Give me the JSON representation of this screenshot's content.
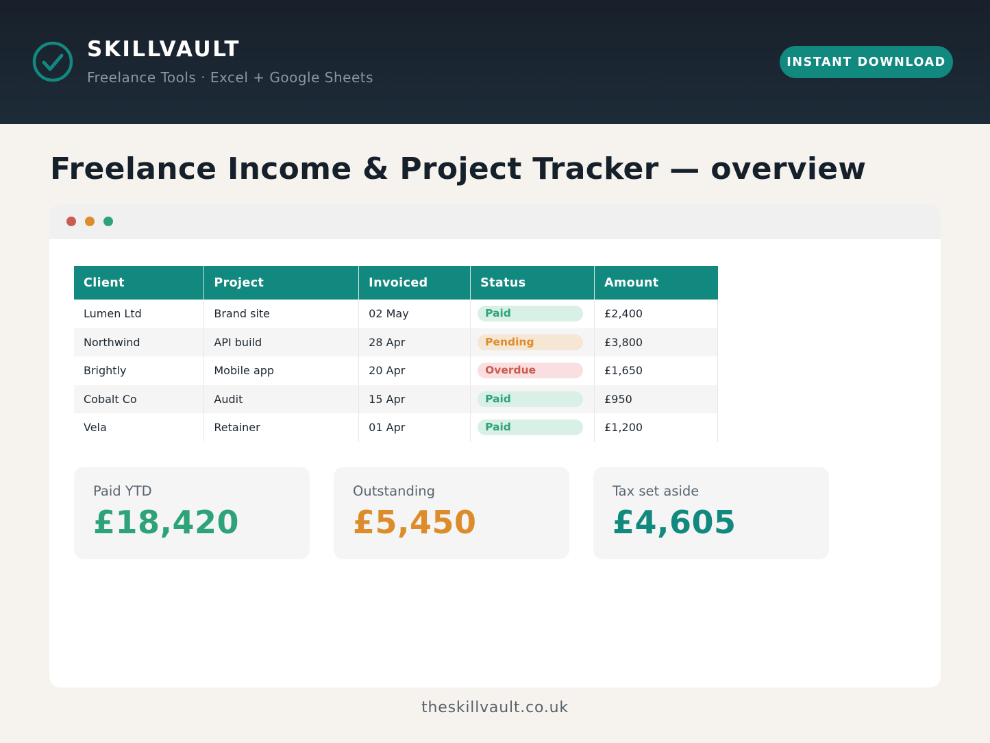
{
  "header": {
    "brand": "SKILLVAULT",
    "tagline": "Freelance Tools · Excel + Google Sheets",
    "cta_label": "INSTANT DOWNLOAD",
    "logo_icon": "check-circle-icon"
  },
  "page": {
    "title": "Freelance Income & Project Tracker — overview"
  },
  "window": {
    "controls": [
      "close",
      "minimize",
      "maximize"
    ]
  },
  "table": {
    "columns": [
      "Client",
      "Project",
      "Invoiced",
      "Status",
      "Amount"
    ],
    "rows": [
      {
        "client": "Lumen Ltd",
        "project": "Brand site",
        "invoiced": "02 May",
        "status": "Paid",
        "amount": "£2,400"
      },
      {
        "client": "Northwind",
        "project": "API build",
        "invoiced": "28 Apr",
        "status": "Pending",
        "amount": "£3,800"
      },
      {
        "client": "Brightly",
        "project": "Mobile app",
        "invoiced": "20 Apr",
        "status": "Overdue",
        "amount": "£1,650"
      },
      {
        "client": "Cobalt Co",
        "project": "Audit",
        "invoiced": "15 Apr",
        "status": "Paid",
        "amount": "£950"
      },
      {
        "client": "Vela",
        "project": "Retainer",
        "invoiced": "01 Apr",
        "status": "Paid",
        "amount": "£1,200"
      }
    ]
  },
  "summary": [
    {
      "label": "Paid YTD",
      "value": "£18,420",
      "color": "#2ea37a"
    },
    {
      "label": "Outstanding",
      "value": "£5,450",
      "color": "#dd8c2b"
    },
    {
      "label": "Tax set aside",
      "value": "£4,605",
      "color": "#12897e"
    }
  ],
  "footer": {
    "url": "theskillvault.co.uk"
  },
  "colors": {
    "header_bg": "#18202a",
    "accent": "#12897e",
    "paid": "#2ea37a",
    "pending": "#dd8c2b",
    "overdue": "#cc5a4f",
    "page_bg": "#f6f3ee"
  }
}
